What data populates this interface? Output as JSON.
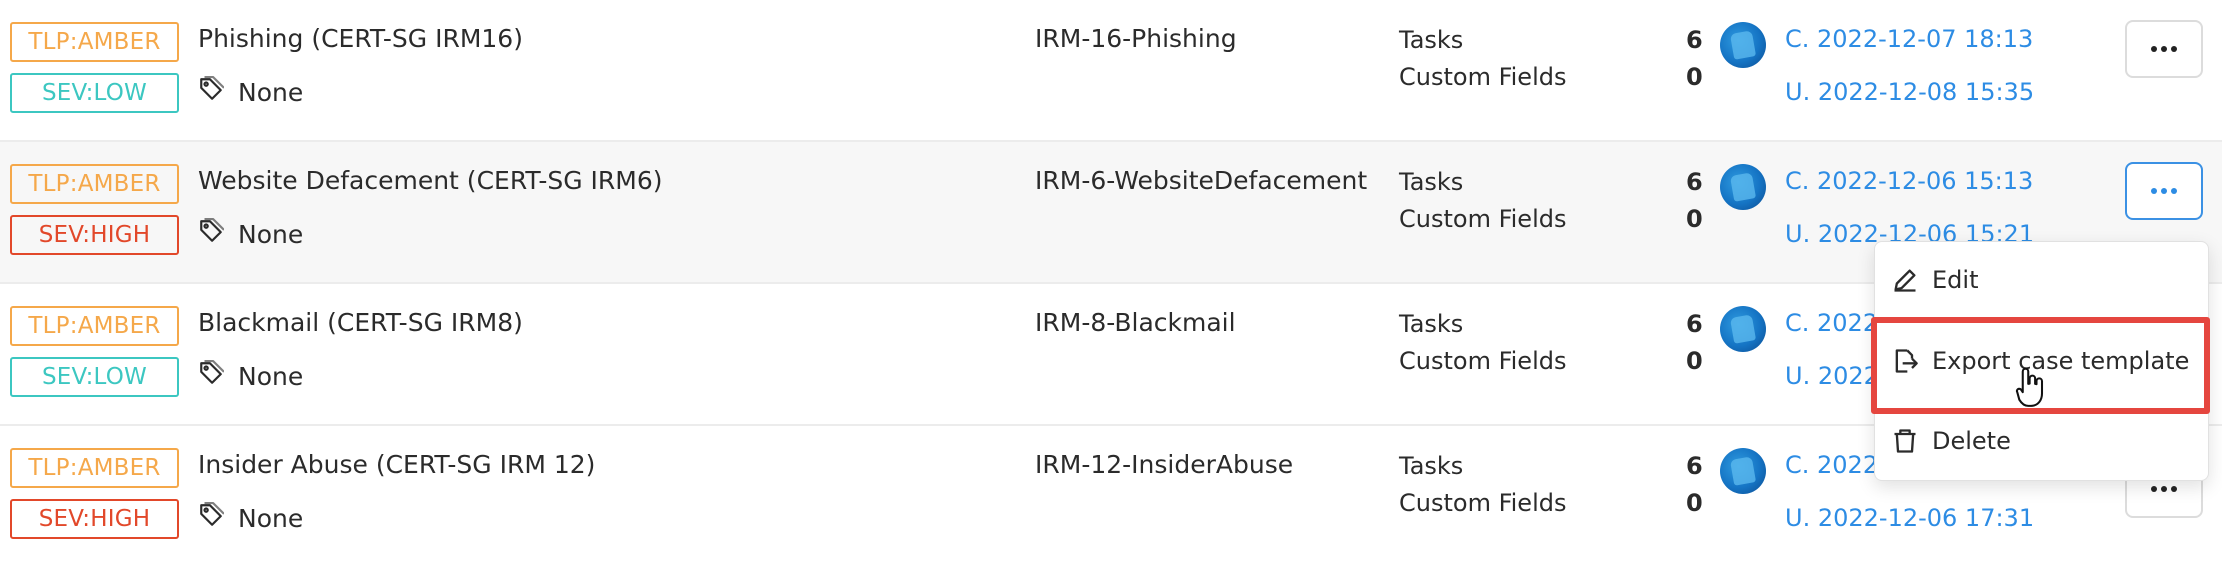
{
  "rows": [
    {
      "tlp": "TLP:AMBER",
      "severity": "SEV:LOW",
      "name": "Phishing (CERT-SG IRM16)",
      "tags": "None",
      "code": "IRM-16-Phishing",
      "tasks_label": "Tasks",
      "custom_fields_label": "Custom Fields",
      "tasks_count": "6",
      "custom_fields_count": "0",
      "created": "C. 2022-12-07 18:13",
      "updated": "U. 2022-12-08 15:35"
    },
    {
      "tlp": "TLP:AMBER",
      "severity": "SEV:HIGH",
      "name": "Website Defacement (CERT-SG IRM6)",
      "tags": "None",
      "code": "IRM-6-WebsiteDefacement",
      "tasks_label": "Tasks",
      "custom_fields_label": "Custom Fields",
      "tasks_count": "6",
      "custom_fields_count": "0",
      "created": "C. 2022-12-06 15:13",
      "updated": "U. 2022-12-06 15:21"
    },
    {
      "tlp": "TLP:AMBER",
      "severity": "SEV:LOW",
      "name": "Blackmail (CERT-SG IRM8)",
      "tags": "None",
      "code": "IRM-8-Blackmail",
      "tasks_label": "Tasks",
      "custom_fields_label": "Custom Fields",
      "tasks_count": "6",
      "custom_fields_count": "0",
      "created": "C. 2022",
      "updated": "U. 2022"
    },
    {
      "tlp": "TLP:AMBER",
      "severity": "SEV:HIGH",
      "name": "Insider Abuse (CERT-SG IRM 12)",
      "tags": "None",
      "code": "IRM-12-InsiderAbuse",
      "tasks_label": "Tasks",
      "custom_fields_label": "Custom Fields",
      "tasks_count": "6",
      "custom_fields_count": "0",
      "created": "C. 2022",
      "updated": "U. 2022-12-06 17:31"
    }
  ],
  "menu": {
    "edit": "Edit",
    "export": "Export case template",
    "delete": "Delete"
  },
  "icons": {
    "tag": "tag-icon",
    "more": "more-horizontal-icon",
    "edit": "pencil-icon",
    "export": "file-export-icon",
    "delete": "trash-icon",
    "cursor": "hand-pointer-cursor"
  },
  "colors": {
    "tlp_amber": "#f5a84a",
    "sev_low": "#3cc7c1",
    "sev_high": "#e2482a",
    "link": "#2d8ce4",
    "highlight": "#e5463f"
  }
}
